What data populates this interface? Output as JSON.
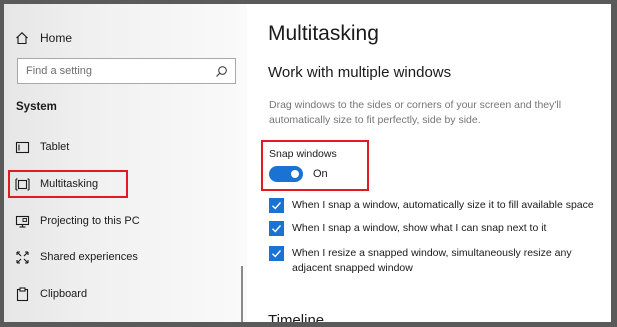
{
  "sidebar": {
    "home_label": "Home",
    "search_placeholder": "Find a setting",
    "section_title": "System",
    "items": [
      {
        "label": "Tablet",
        "icon": "tablet-icon"
      },
      {
        "label": "Multitasking",
        "icon": "multitasking-icon",
        "selected": true
      },
      {
        "label": "Projecting to this PC",
        "icon": "projecting-icon"
      },
      {
        "label": "Shared experiences",
        "icon": "shared-experiences-icon"
      },
      {
        "label": "Clipboard",
        "icon": "clipboard-icon"
      }
    ]
  },
  "main": {
    "title": "Multitasking",
    "subheading": "Work with multiple windows",
    "description": "Drag windows to the sides or corners of your screen and they'll automatically size to fit perfectly, side by side.",
    "snap": {
      "label": "Snap windows",
      "state_label": "On",
      "on": true
    },
    "checkboxes": [
      {
        "label": "When I snap a window, automatically size it to fill available space",
        "checked": true
      },
      {
        "label": "When I snap a window, show what I can snap next to it",
        "checked": true
      },
      {
        "label": "When I resize a snapped window, simultaneously resize any adjacent snapped window",
        "checked": true
      }
    ],
    "next_section": "Timeline"
  },
  "colors": {
    "accent": "#1a73d2",
    "highlight": "#e01b24"
  }
}
